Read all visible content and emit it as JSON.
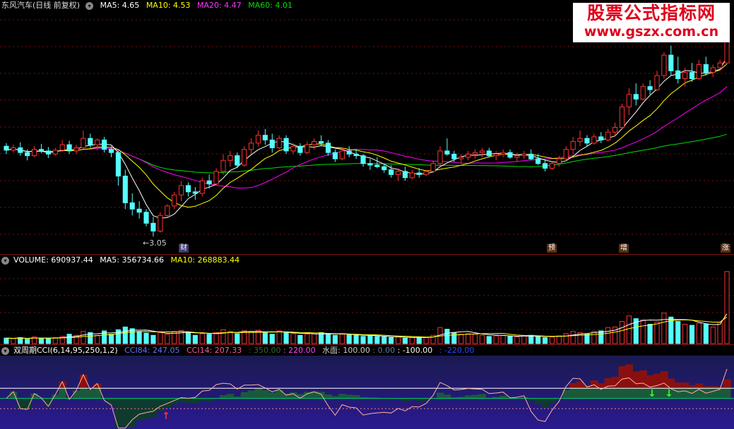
{
  "price_header": {
    "title": "东风汽车(日线 前复权)",
    "ma5": "MA5: 4.65",
    "ma10": "MA10: 4.53",
    "ma20": "MA20: 4.47",
    "ma60": "MA60: 4.01"
  },
  "price_low_label": "←3.05",
  "event_badges": [
    "财",
    "预",
    "增",
    "涨"
  ],
  "volume_header": {
    "vol": "VOLUME: 690937.44",
    "ma5": "MA5: 356734.66",
    "ma10": "MA10: 268883.44"
  },
  "cci_header": {
    "name": "双周期CCI(6,14,95,250,1,2)",
    "cci84": "CCI84: 247.05",
    "cci14": "CCI14: 207.33",
    "l350": ": 350.00",
    "l220": ": 220.00",
    "water": "水面: 100.00",
    "zero": ": 0.00",
    "neg100": ": -100.00",
    "neg220": ": -220.00"
  },
  "watermark": {
    "line1": "股票公式指标网",
    "line2": "www.gszx.com.cn"
  },
  "colors": {
    "up": "#ff3232",
    "down": "#54ffff",
    "ma5": "#ffffff",
    "ma10": "#ffff00",
    "ma20": "#ff00ff",
    "ma60": "#00e000",
    "bg": "#000000",
    "grid": "#7a1010"
  },
  "chart_data": {
    "type": "candlestick",
    "ylim": [
      2.9,
      5.9
    ],
    "ohlc": [
      [
        4.2,
        4.24,
        4.1,
        4.15
      ],
      [
        4.15,
        4.22,
        4.12,
        4.18
      ],
      [
        4.18,
        4.25,
        4.08,
        4.12
      ],
      [
        4.12,
        4.16,
        4.02,
        4.08
      ],
      [
        4.08,
        4.2,
        4.06,
        4.16
      ],
      [
        4.16,
        4.23,
        4.11,
        4.14
      ],
      [
        4.14,
        4.19,
        4.05,
        4.1
      ],
      [
        4.1,
        4.18,
        4.08,
        4.15
      ],
      [
        4.15,
        4.28,
        4.13,
        4.22
      ],
      [
        4.22,
        4.27,
        4.1,
        4.14
      ],
      [
        4.14,
        4.22,
        4.1,
        4.18
      ],
      [
        4.18,
        4.4,
        4.16,
        4.3
      ],
      [
        4.3,
        4.36,
        4.18,
        4.22
      ],
      [
        4.22,
        4.3,
        4.15,
        4.28
      ],
      [
        4.28,
        4.32,
        4.12,
        4.16
      ],
      [
        4.16,
        4.2,
        4.06,
        4.12
      ],
      [
        4.12,
        4.14,
        3.7,
        3.82
      ],
      [
        3.82,
        3.9,
        3.4,
        3.48
      ],
      [
        3.48,
        3.6,
        3.32,
        3.4
      ],
      [
        3.4,
        3.5,
        3.28,
        3.36
      ],
      [
        3.36,
        3.4,
        3.18,
        3.22
      ],
      [
        3.22,
        3.3,
        3.05,
        3.12
      ],
      [
        3.12,
        3.36,
        3.1,
        3.32
      ],
      [
        3.32,
        3.46,
        3.3,
        3.44
      ],
      [
        3.44,
        3.62,
        3.4,
        3.58
      ],
      [
        3.58,
        3.76,
        3.5,
        3.7
      ],
      [
        3.7,
        3.74,
        3.56,
        3.62
      ],
      [
        3.62,
        3.68,
        3.52,
        3.6
      ],
      [
        3.6,
        3.8,
        3.56,
        3.76
      ],
      [
        3.76,
        3.84,
        3.66,
        3.72
      ],
      [
        3.72,
        3.92,
        3.7,
        3.88
      ],
      [
        3.88,
        4.1,
        3.84,
        4.02
      ],
      [
        4.02,
        4.14,
        3.94,
        4.08
      ],
      [
        4.08,
        4.12,
        3.92,
        3.96
      ],
      [
        3.96,
        4.2,
        3.94,
        4.16
      ],
      [
        4.16,
        4.3,
        4.1,
        4.24
      ],
      [
        4.24,
        4.4,
        4.2,
        4.34
      ],
      [
        4.34,
        4.42,
        4.22,
        4.28
      ],
      [
        4.28,
        4.36,
        4.12,
        4.18
      ],
      [
        4.18,
        4.34,
        4.16,
        4.3
      ],
      [
        4.3,
        4.34,
        4.1,
        4.14
      ],
      [
        4.14,
        4.24,
        4.1,
        4.2
      ],
      [
        4.2,
        4.24,
        4.08,
        4.12
      ],
      [
        4.12,
        4.26,
        4.1,
        4.22
      ],
      [
        4.22,
        4.3,
        4.16,
        4.26
      ],
      [
        4.26,
        4.34,
        4.2,
        4.24
      ],
      [
        4.24,
        4.28,
        4.08,
        4.12
      ],
      [
        4.12,
        4.16,
        4.0,
        4.04
      ],
      [
        4.04,
        4.18,
        4.02,
        4.14
      ],
      [
        4.14,
        4.2,
        4.06,
        4.1
      ],
      [
        4.1,
        4.16,
        4.04,
        4.08
      ],
      [
        4.08,
        4.1,
        3.94,
        3.98
      ],
      [
        3.98,
        4.04,
        3.9,
        3.96
      ],
      [
        3.96,
        4.06,
        3.92,
        3.94
      ],
      [
        3.94,
        3.98,
        3.86,
        3.9
      ],
      [
        3.9,
        3.96,
        3.8,
        3.84
      ],
      [
        3.84,
        3.92,
        3.76,
        3.88
      ],
      [
        3.88,
        3.94,
        3.76,
        3.8
      ],
      [
        3.8,
        3.9,
        3.78,
        3.86
      ],
      [
        3.86,
        3.92,
        3.8,
        3.84
      ],
      [
        3.84,
        3.9,
        3.82,
        3.88
      ],
      [
        3.88,
        4.02,
        3.86,
        3.98
      ],
      [
        3.98,
        4.2,
        3.96,
        4.14
      ],
      [
        4.14,
        4.3,
        4.08,
        4.1
      ],
      [
        4.1,
        4.14,
        4.0,
        4.04
      ],
      [
        4.04,
        4.1,
        3.98,
        4.06
      ],
      [
        4.06,
        4.14,
        4.02,
        4.1
      ],
      [
        4.1,
        4.16,
        4.04,
        4.12
      ],
      [
        4.12,
        4.18,
        4.06,
        4.14
      ],
      [
        4.14,
        4.18,
        4.06,
        4.08
      ],
      [
        4.08,
        4.14,
        4.02,
        4.1
      ],
      [
        4.1,
        4.16,
        4.06,
        4.12
      ],
      [
        4.12,
        4.16,
        4.04,
        4.06
      ],
      [
        4.06,
        4.12,
        4.0,
        4.08
      ],
      [
        4.08,
        4.14,
        4.04,
        4.1
      ],
      [
        4.1,
        4.16,
        4.02,
        4.04
      ],
      [
        4.04,
        4.1,
        3.96,
        3.98
      ],
      [
        3.98,
        4.02,
        3.88,
        3.92
      ],
      [
        3.92,
        4.0,
        3.9,
        3.98
      ],
      [
        3.98,
        4.08,
        3.94,
        4.04
      ],
      [
        4.04,
        4.2,
        4.02,
        4.16
      ],
      [
        4.16,
        4.32,
        4.1,
        4.26
      ],
      [
        4.26,
        4.4,
        4.2,
        4.3
      ],
      [
        4.3,
        4.34,
        4.2,
        4.24
      ],
      [
        4.24,
        4.36,
        4.22,
        4.32
      ],
      [
        4.32,
        4.38,
        4.24,
        4.28
      ],
      [
        4.28,
        4.42,
        4.26,
        4.38
      ],
      [
        4.38,
        4.5,
        4.32,
        4.44
      ],
      [
        4.44,
        4.74,
        4.42,
        4.7
      ],
      [
        4.7,
        4.94,
        4.6,
        4.86
      ],
      [
        4.86,
        5.0,
        4.72,
        4.8
      ],
      [
        4.8,
        5.0,
        4.78,
        4.96
      ],
      [
        4.96,
        5.04,
        4.86,
        4.92
      ],
      [
        4.92,
        5.16,
        4.9,
        5.1
      ],
      [
        5.1,
        5.4,
        5.06,
        5.36
      ],
      [
        5.36,
        5.48,
        5.1,
        5.16
      ],
      [
        5.16,
        5.34,
        5.0,
        5.06
      ],
      [
        5.06,
        5.2,
        4.96,
        5.14
      ],
      [
        5.14,
        5.26,
        5.02,
        5.06
      ],
      [
        5.06,
        5.3,
        5.04,
        5.24
      ],
      [
        5.24,
        5.34,
        5.1,
        5.14
      ],
      [
        5.14,
        5.24,
        5.08,
        5.2
      ],
      [
        5.2,
        5.3,
        5.16,
        5.26
      ],
      [
        5.26,
        5.9,
        5.24,
        5.84
      ]
    ],
    "volume": [
      20,
      18,
      22,
      16,
      24,
      20,
      18,
      22,
      26,
      34,
      30,
      44,
      40,
      30,
      46,
      34,
      50,
      60,
      54,
      44,
      38,
      30,
      40,
      34,
      44,
      46,
      40,
      30,
      36,
      34,
      40,
      50,
      44,
      36,
      46,
      44,
      48,
      40,
      34,
      46,
      40,
      36,
      30,
      34,
      36,
      40,
      34,
      30,
      34,
      32,
      30,
      26,
      28,
      26,
      24,
      22,
      24,
      20,
      22,
      24,
      22,
      30,
      58,
      52,
      40,
      34,
      36,
      34,
      30,
      26,
      28,
      30,
      26,
      24,
      28,
      30,
      26,
      22,
      24,
      28,
      36,
      44,
      40,
      34,
      44,
      46,
      58,
      60,
      80,
      100,
      90,
      86,
      70,
      78,
      110,
      96,
      80,
      70,
      66,
      74,
      70,
      60,
      76,
      260
    ],
    "volume_ylim": [
      0,
      280
    ]
  }
}
